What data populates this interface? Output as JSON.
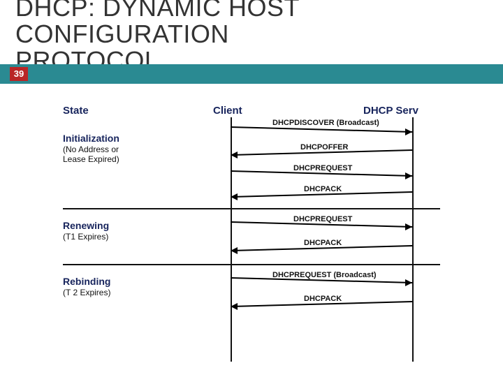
{
  "title_line1": "DHCP: DYNAMIC HOST",
  "title_line2": "CONFIGURATION",
  "title_line3": "PROTOCOL",
  "page_number": "39",
  "headers": {
    "state": "State",
    "client": "Client",
    "server": "DHCP Serv"
  },
  "states": {
    "init": {
      "label": "Initialization",
      "sub1": "(No Address or",
      "sub2": "Lease Expired)"
    },
    "renew": {
      "label": "Renewing",
      "sub1": "(T1 Expires)"
    },
    "rebind": {
      "label": "Rebinding",
      "sub1": "(T 2 Expires)"
    }
  },
  "messages": {
    "discover": "DHCPDISCOVER (Broadcast)",
    "offer": "DHCPOFFER",
    "request": "DHCPREQUEST",
    "ack1": "DHCPACK",
    "request2": "DHCPREQUEST",
    "ack2": "DHCPACK",
    "request_bc": "DHCPREQUEST (Broadcast)",
    "ack3": "DHCPACK"
  }
}
